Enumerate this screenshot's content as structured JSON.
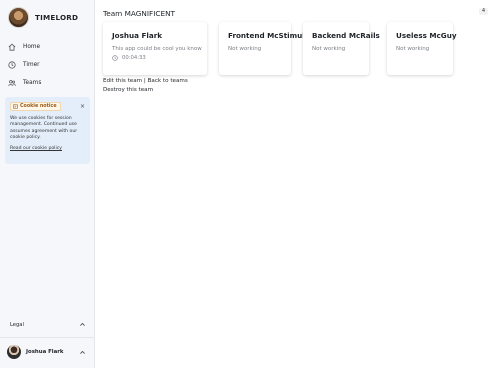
{
  "app": {
    "brand": "TIMELORD"
  },
  "sidebar": {
    "items": [
      {
        "label": "Home",
        "icon": "home-icon"
      },
      {
        "label": "Timer",
        "icon": "clock-icon"
      },
      {
        "label": "Teams",
        "icon": "users-icon"
      }
    ],
    "cookie": {
      "title": "Cookie notice",
      "close": "×",
      "text": "We use cookies for session management. Continued use assumes agreement with our cookie policy.",
      "link": "Read our cookie policy"
    },
    "legal": "Legal",
    "user": {
      "name": "Joshua Flark"
    }
  },
  "main": {
    "title": "Team MAGNIFICENT",
    "badge": "4",
    "cards": [
      {
        "name": "Joshua Flark",
        "status": "This app could be cool you know",
        "timer": "00:04:33"
      },
      {
        "name": "Frontend McStimulus",
        "status": "Not working"
      },
      {
        "name": "Backend McRails",
        "status": "Not working"
      },
      {
        "name": "Useless McGuy",
        "status": "Not working"
      }
    ],
    "links": {
      "edit": "Edit this team",
      "separator": " | ",
      "back": "Back to teams",
      "destroy": "Destroy this team"
    }
  },
  "colors": {
    "sidebar_bg": "#f5f7fa",
    "cookie_bg": "#e3eefa",
    "cookie_accent": "#9a5a14"
  }
}
